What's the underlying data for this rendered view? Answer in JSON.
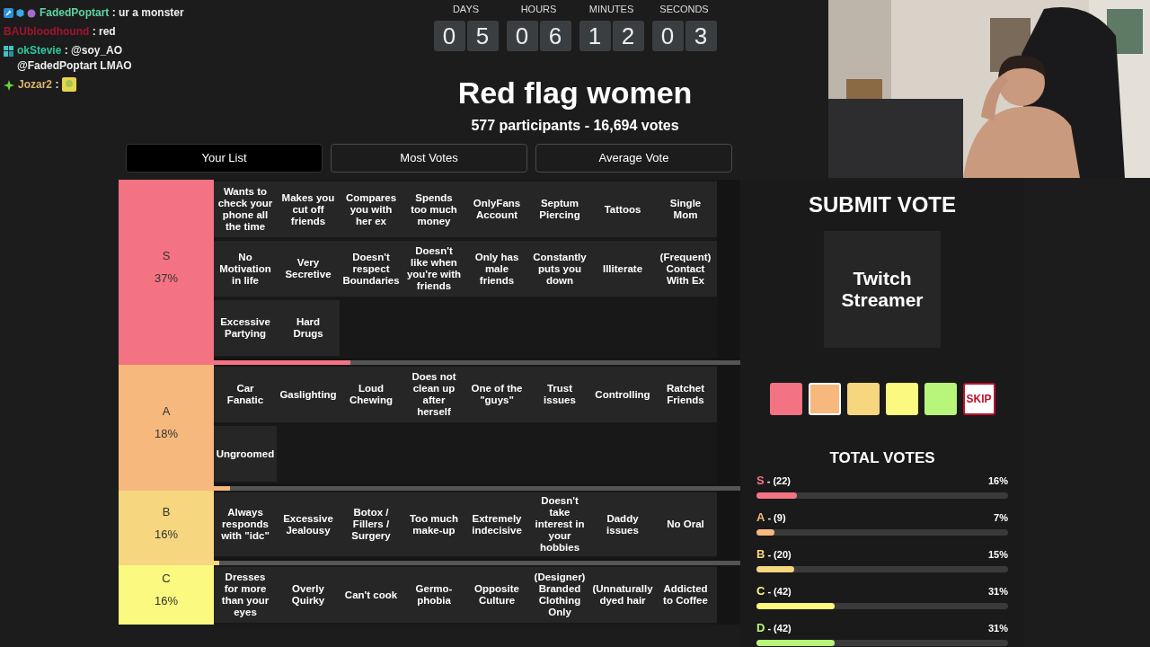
{
  "chat": [
    {
      "user": "FadedPoptart",
      "color": "#5fd3a6",
      "kind": "text",
      "message": ": ur a monster"
    },
    {
      "user": "BAUbloodhound",
      "color": "#a3132f",
      "kind": "text",
      "message": ": red"
    },
    {
      "user": "okStevie",
      "color": "#2fc7a2",
      "kind": "text",
      "message": ": @soy_AO @FadedPoptart LMAO"
    },
    {
      "user": "Jozar2",
      "color": "#dcb46c",
      "kind": "emote",
      "message": ":"
    }
  ],
  "countdown": [
    {
      "label": "DAYS",
      "digits": [
        "0",
        "5"
      ]
    },
    {
      "label": "HOURS",
      "digits": [
        "0",
        "6"
      ]
    },
    {
      "label": "MINUTES",
      "digits": [
        "1",
        "2"
      ]
    },
    {
      "label": "SECONDS",
      "digits": [
        "0",
        "3"
      ]
    }
  ],
  "title": "Red flag women",
  "subtitle": "577 participants - 16,694 votes",
  "tabs": [
    {
      "label": "Your List",
      "selected": true
    },
    {
      "label": "Most Votes",
      "selected": false
    },
    {
      "label": "Average Vote",
      "selected": false
    }
  ],
  "tiers": [
    {
      "label": "S",
      "percent": "37%",
      "color": "#f47383",
      "level": 0.26,
      "items": [
        "Wants to check your phone all the time",
        "Makes you cut off friends",
        "Compares you with her ex",
        "Spends too much money",
        "OnlyFans Account",
        "Septum Piercing",
        "Tattoos",
        "Single Mom",
        "No Motivation in life",
        "Very Secretive",
        "Doesn't respect Boundaries",
        "Doesn't like when you're with friends",
        "Only has male friends",
        "Constantly puts you down",
        "Illiterate",
        "(Frequent) Contact With Ex",
        "Excessive Partying",
        "Hard Drugs"
      ]
    },
    {
      "label": "A",
      "percent": "18%",
      "color": "#f6b87d",
      "level": 0.03,
      "items": [
        "Car Fanatic",
        "Gaslighting",
        "Loud Chewing",
        "Does not clean up after herself",
        "One of the \"guys\"",
        "Trust issues",
        "Controlling",
        "Ratchet Friends",
        "Ungroomed"
      ]
    },
    {
      "label": "B",
      "percent": "16%",
      "color": "#f6d67e",
      "level": 0.01,
      "items": [
        "Always responds with \"idc\"",
        "Excessive Jealousy",
        "Botox / Fillers / Surgery",
        "Too much make-up",
        "Extremely indecisive",
        "Doesn't take interest in your hobbies",
        "Daddy issues",
        "No Oral"
      ]
    },
    {
      "label": "C",
      "percent": "16%",
      "color": "#fbf97f",
      "items": [
        "Dresses for more than your eyes",
        "Overly Quirky",
        "Can't cook",
        "Germo-phobia",
        "Opposite Culture",
        "(Designer) Branded Clothing Only",
        "(Unnaturally dyed hair",
        "Addicted to Coffee"
      ]
    }
  ],
  "vote": {
    "heading": "SUBMIT VOTE",
    "card": "Twitch Streamer",
    "choices": [
      {
        "kind": "color",
        "color": "#f47383",
        "selected": false
      },
      {
        "kind": "color",
        "color": "#f6b87d",
        "selected": true
      },
      {
        "kind": "color",
        "color": "#f6d67e",
        "selected": false
      },
      {
        "kind": "color",
        "color": "#fbf97f",
        "selected": false
      },
      {
        "kind": "color",
        "color": "#b8f57b",
        "selected": false
      },
      {
        "kind": "skip",
        "label": "SKIP",
        "selected": false
      }
    ]
  },
  "totals": {
    "heading": "TOTAL VOTES",
    "rows": [
      {
        "tier": "S",
        "count": "- (22)",
        "percent": "16%",
        "color": "#f47383",
        "level": 0.16
      },
      {
        "tier": "A",
        "count": "- (9)",
        "percent": "7%",
        "color": "#f6b87d",
        "level": 0.07
      },
      {
        "tier": "B",
        "count": "- (20)",
        "percent": "15%",
        "color": "#f6d67e",
        "level": 0.15
      },
      {
        "tier": "C",
        "count": "- (42)",
        "percent": "31%",
        "color": "#fbf97f",
        "level": 0.31
      },
      {
        "tier": "D",
        "count": "- (42)",
        "percent": "31%",
        "color": "#b8f57b",
        "level": 0.31
      }
    ]
  }
}
